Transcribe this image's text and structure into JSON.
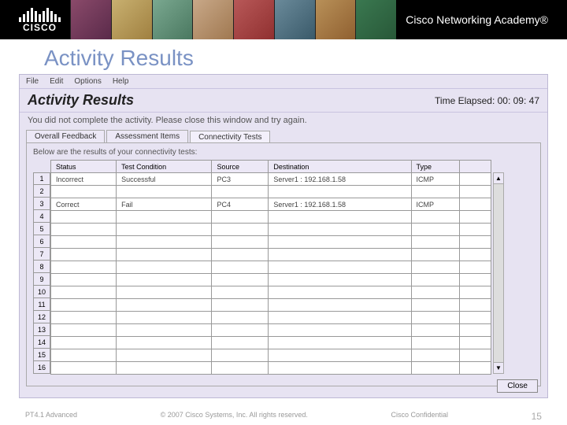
{
  "banner": {
    "logo_text": "CISCO",
    "academy": "Cisco Networking Academy®"
  },
  "slide_title": "Activity Results",
  "menu": {
    "file": "File",
    "edit": "Edit",
    "options": "Options",
    "help": "Help"
  },
  "header": {
    "title": "Activity Results",
    "time_label": "Time Elapsed: 00: 09: 47"
  },
  "message": "You did not complete the activity. Please close this window and try again.",
  "tabs": {
    "overall": "Overall Feedback",
    "assessment": "Assessment Items",
    "connectivity": "Connectivity Tests"
  },
  "panel_msg": "Below are the results of your connectivity tests:",
  "columns": {
    "status": "Status",
    "condition": "Test Condition",
    "source": "Source",
    "destination": "Destination",
    "type": "Type"
  },
  "rows": [
    {
      "n": "1",
      "status": "Incorrect",
      "condition": "Successful",
      "source": "PC3",
      "destination": "Server1 : 192.168.1.58",
      "type": "ICMP"
    },
    {
      "n": "2",
      "status": "",
      "condition": "",
      "source": "",
      "destination": "",
      "type": ""
    },
    {
      "n": "3",
      "status": "Correct",
      "condition": "Fail",
      "source": "PC4",
      "destination": "Server1 : 192.168.1.58",
      "type": "ICMP"
    },
    {
      "n": "4",
      "status": "",
      "condition": "",
      "source": "",
      "destination": "",
      "type": ""
    },
    {
      "n": "5",
      "status": "",
      "condition": "",
      "source": "",
      "destination": "",
      "type": ""
    },
    {
      "n": "6",
      "status": "",
      "condition": "",
      "source": "",
      "destination": "",
      "type": ""
    },
    {
      "n": "7",
      "status": "",
      "condition": "",
      "source": "",
      "destination": "",
      "type": ""
    },
    {
      "n": "8",
      "status": "",
      "condition": "",
      "source": "",
      "destination": "",
      "type": ""
    },
    {
      "n": "9",
      "status": "",
      "condition": "",
      "source": "",
      "destination": "",
      "type": ""
    },
    {
      "n": "10",
      "status": "",
      "condition": "",
      "source": "",
      "destination": "",
      "type": ""
    },
    {
      "n": "11",
      "status": "",
      "condition": "",
      "source": "",
      "destination": "",
      "type": ""
    },
    {
      "n": "12",
      "status": "",
      "condition": "",
      "source": "",
      "destination": "",
      "type": ""
    },
    {
      "n": "13",
      "status": "",
      "condition": "",
      "source": "",
      "destination": "",
      "type": ""
    },
    {
      "n": "14",
      "status": "",
      "condition": "",
      "source": "",
      "destination": "",
      "type": ""
    },
    {
      "n": "15",
      "status": "",
      "condition": "",
      "source": "",
      "destination": "",
      "type": ""
    },
    {
      "n": "16",
      "status": "",
      "condition": "",
      "source": "",
      "destination": "",
      "type": ""
    }
  ],
  "close_label": "Close",
  "footer": {
    "left": "PT4.1 Advanced",
    "center": "© 2007 Cisco Systems, Inc. All rights reserved.",
    "right": "Cisco Confidential",
    "page": "15"
  }
}
